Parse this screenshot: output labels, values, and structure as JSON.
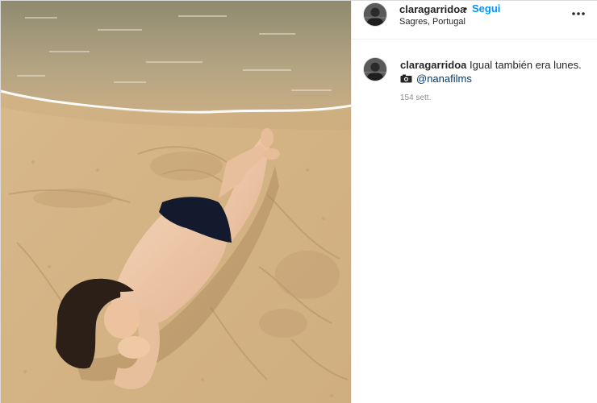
{
  "post": {
    "photo": {
      "description_icon": "beach-photo",
      "colors": {
        "sand": "#d7b88c",
        "sea": "#a89c7a",
        "foam": "#ffffff",
        "swimwear": "#141a2e"
      }
    },
    "header": {
      "username": "claragarridoa",
      "separator": "•",
      "follow_label": "Segui",
      "location": "Sagres, Portugal",
      "more_icon": "more-horizontal-icon"
    },
    "caption": {
      "username": "claragarridoa",
      "text": "Igual también era lunes.",
      "camera_icon": "camera-icon",
      "mention": "@nanafilms",
      "time": "154 sett."
    },
    "colors": {
      "follow": "#0095f6",
      "mention": "#00376b",
      "muted": "#8e8e8e",
      "border": "#dbdbdb"
    }
  }
}
